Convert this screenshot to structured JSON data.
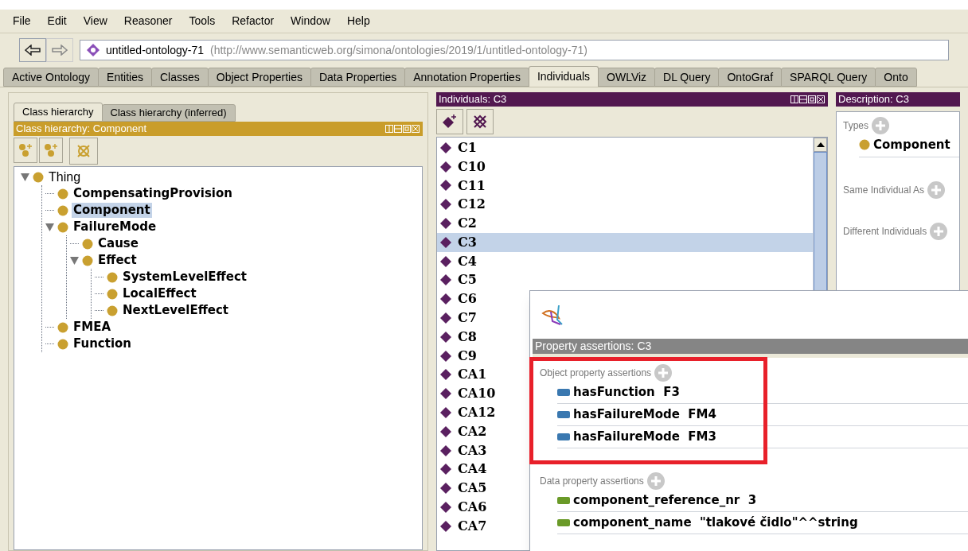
{
  "menu": [
    "File",
    "Edit",
    "View",
    "Reasoner",
    "Tools",
    "Refactor",
    "Window",
    "Help"
  ],
  "address": {
    "name": "untitled-ontology-71",
    "iri": "(http://www.semanticweb.org/simona/ontologies/2019/1/untitled-ontology-71)"
  },
  "tabs": [
    {
      "label": "Active Ontology",
      "selected": false
    },
    {
      "label": "Entities",
      "selected": false
    },
    {
      "label": "Classes",
      "selected": false
    },
    {
      "label": "Object Properties",
      "selected": false
    },
    {
      "label": "Data Properties",
      "selected": false
    },
    {
      "label": "Annotation Properties",
      "selected": false
    },
    {
      "label": "Individuals",
      "selected": true
    },
    {
      "label": "OWLViz",
      "selected": false
    },
    {
      "label": "DL Query",
      "selected": false
    },
    {
      "label": "OntoGraf",
      "selected": false
    },
    {
      "label": "SPARQL Query",
      "selected": false
    },
    {
      "label": "Onto",
      "selected": false
    }
  ],
  "class_panel": {
    "subtabs": [
      {
        "label": "Class hierarchy",
        "selected": true
      },
      {
        "label": "Class hierarchy (inferred)",
        "selected": false
      }
    ],
    "title": "Class hierarchy: Component",
    "tree": [
      {
        "label": "Thing",
        "selected": false,
        "expanded": true,
        "children": [
          {
            "label": "CompensatingProvision",
            "selected": false
          },
          {
            "label": "Component",
            "selected": true
          },
          {
            "label": "FailureMode",
            "selected": false,
            "expanded": true,
            "children": [
              {
                "label": "Cause",
                "selected": false
              },
              {
                "label": "Effect",
                "selected": false,
                "expanded": true,
                "children": [
                  {
                    "label": "SystemLevelEffect",
                    "selected": false
                  },
                  {
                    "label": "LocalEffect",
                    "selected": false
                  },
                  {
                    "label": "NextLevelEffect",
                    "selected": false
                  }
                ]
              }
            ]
          },
          {
            "label": "FMEA",
            "selected": false
          },
          {
            "label": "Function",
            "selected": false
          }
        ]
      }
    ]
  },
  "individuals_panel": {
    "title": "Individuals: C3",
    "items": [
      {
        "label": "C1",
        "selected": false
      },
      {
        "label": "C10",
        "selected": false
      },
      {
        "label": "C11",
        "selected": false
      },
      {
        "label": "C12",
        "selected": false
      },
      {
        "label": "C2",
        "selected": false
      },
      {
        "label": "C3",
        "selected": true
      },
      {
        "label": "C4",
        "selected": false
      },
      {
        "label": "C5",
        "selected": false
      },
      {
        "label": "C6",
        "selected": false
      },
      {
        "label": "C7",
        "selected": false
      },
      {
        "label": "C8",
        "selected": false
      },
      {
        "label": "C9",
        "selected": false
      },
      {
        "label": "CA1",
        "selected": false
      },
      {
        "label": "CA10",
        "selected": false
      },
      {
        "label": "CA12",
        "selected": false
      },
      {
        "label": "CA2",
        "selected": false
      },
      {
        "label": "CA3",
        "selected": false
      },
      {
        "label": "CA4",
        "selected": false
      },
      {
        "label": "CA5",
        "selected": false
      },
      {
        "label": "CA6",
        "selected": false
      },
      {
        "label": "CA7",
        "selected": false
      }
    ]
  },
  "description_panel": {
    "title": "Description: C3",
    "types_label": "Types",
    "types": [
      "Component"
    ],
    "same_label": "Same Individual As",
    "different_label": "Different Individuals"
  },
  "assertions_panel": {
    "title": "Property assertions: C3",
    "object_label": "Object property assertions",
    "object_assertions": [
      {
        "property": "hasFunction",
        "value": "F3"
      },
      {
        "property": "hasFailureMode",
        "value": "FM4"
      },
      {
        "property": "hasFailureMode",
        "value": "FM3"
      }
    ],
    "data_label": "Data property assertions",
    "data_assertions": [
      {
        "property": "component_reference_nr",
        "value": "3"
      },
      {
        "property": "component_name",
        "value": "\"tlakové čidlo\"^^string"
      }
    ]
  }
}
